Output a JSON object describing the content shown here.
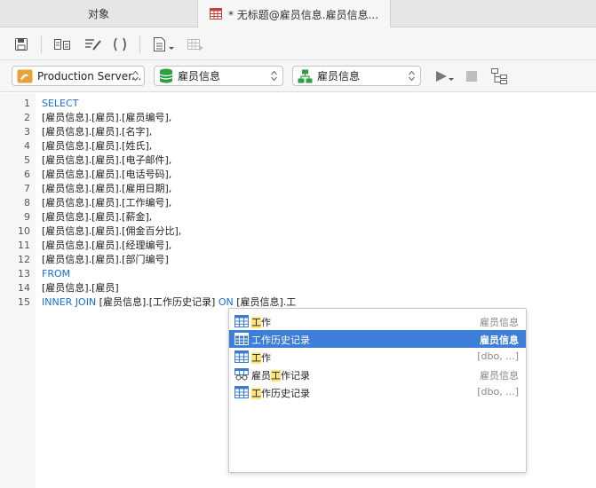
{
  "tabs": {
    "objects_label": "对象",
    "query_label": "* 无标题@雇员信息.雇员信息..."
  },
  "connection": {
    "server": "Production Server...",
    "database": "雇员信息",
    "schema": "雇员信息"
  },
  "editor": {
    "lines": [
      {
        "n": "1",
        "kw": "SELECT",
        "text": ""
      },
      {
        "n": "2",
        "kw": "",
        "text": "[雇员信息].[雇员].[雇员编号],"
      },
      {
        "n": "3",
        "kw": "",
        "text": "[雇员信息].[雇员].[名字],"
      },
      {
        "n": "4",
        "kw": "",
        "text": "[雇员信息].[雇员].[姓氏],"
      },
      {
        "n": "5",
        "kw": "",
        "text": "[雇员信息].[雇员].[电子邮件],"
      },
      {
        "n": "6",
        "kw": "",
        "text": "[雇员信息].[雇员].[电话号码],"
      },
      {
        "n": "7",
        "kw": "",
        "text": "[雇员信息].[雇员].[雇用日期],"
      },
      {
        "n": "8",
        "kw": "",
        "text": "[雇员信息].[雇员].[工作编号],"
      },
      {
        "n": "9",
        "kw": "",
        "text": "[雇员信息].[雇员].[薪金],"
      },
      {
        "n": "10",
        "kw": "",
        "text": "[雇员信息].[雇员].[佣金百分比],"
      },
      {
        "n": "11",
        "kw": "",
        "text": "[雇员信息].[雇员].[经理编号],"
      },
      {
        "n": "12",
        "kw": "",
        "text": "[雇员信息].[雇员].[部门编号]"
      },
      {
        "n": "13",
        "kw": "FROM",
        "text": ""
      },
      {
        "n": "14",
        "kw": "",
        "text": "[雇员信息].[雇员]"
      }
    ],
    "line15": {
      "n": "15",
      "kw1": "INNER JOIN",
      "part1": " [雇员信息].[工作历史记录] ",
      "kw2": "ON",
      "part2": " [雇员信息].工"
    }
  },
  "autocomplete": {
    "items": [
      {
        "pre": "",
        "hl": "工",
        "post": "作",
        "schema": "雇员信息",
        "icon": "table-icon",
        "selected": false
      },
      {
        "pre": "",
        "hl": "工",
        "post": "作历史记录",
        "schema": "雇员信息",
        "icon": "table-icon",
        "selected": true
      },
      {
        "pre": "",
        "hl": "工",
        "post": "作",
        "schema": "[dbo, ...]",
        "icon": "table-icon",
        "selected": false
      },
      {
        "pre": "雇员",
        "hl": "工",
        "post": "作记录",
        "schema": "雇员信息",
        "icon": "view-icon",
        "selected": false
      },
      {
        "pre": "",
        "hl": "工",
        "post": "作历史记录",
        "schema": "[dbo, ...]",
        "icon": "table-icon",
        "selected": false
      }
    ]
  },
  "colors": {
    "keyword": "#1a6fd6",
    "selection": "#3d7fd8",
    "match_highlight": "#fbe57d"
  }
}
